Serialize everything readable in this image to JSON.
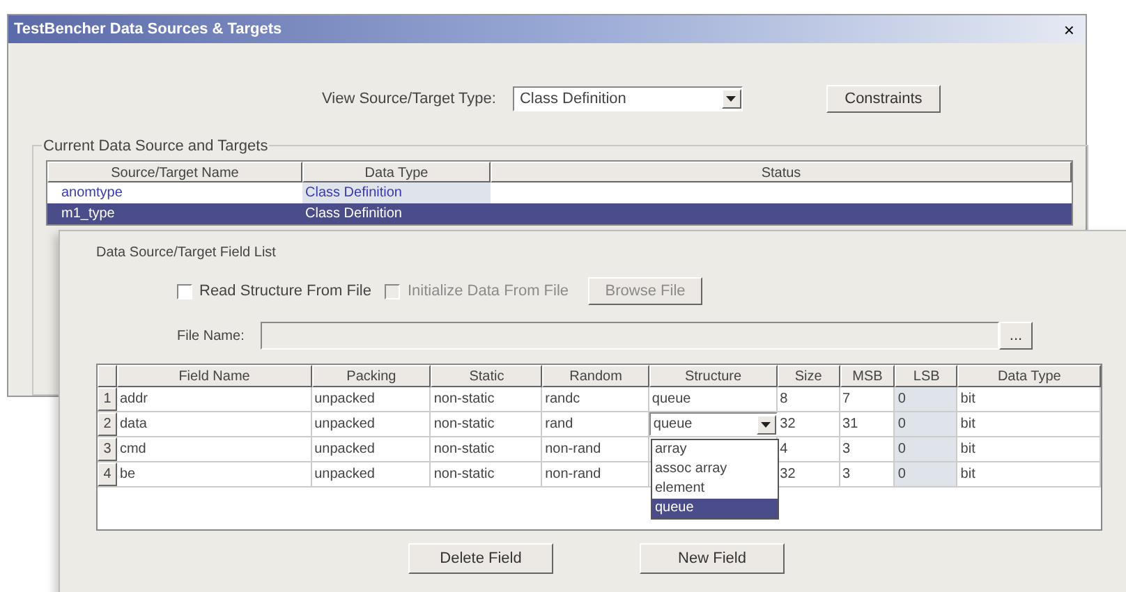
{
  "back_window": {
    "title": "TestBencher Data Sources & Targets",
    "close": "×",
    "type_label": "View Source/Target Type:",
    "type_value": "Class Definition",
    "constraints_button": "Constraints",
    "group_title": "Current Data Source and Targets",
    "columns": [
      "Source/Target Name",
      "Data Type",
      "Status"
    ],
    "rows": [
      {
        "name": "anomtype",
        "data_type": "Class Definition",
        "selected": false
      },
      {
        "name": "m1_type",
        "data_type": "Class Definition",
        "selected": true
      }
    ]
  },
  "field_panel": {
    "title": "Data Source/Target Field List",
    "checkboxes": [
      {
        "label": "Read Structure From File",
        "checked": false,
        "disabled": false
      },
      {
        "label": "Initialize Data From File",
        "checked": false,
        "disabled": true
      }
    ],
    "browse_button": {
      "label": "Browse File",
      "disabled": true
    },
    "file_name_label": "File Name:",
    "ellipsis_button": "...",
    "columns": [
      "Field Name",
      "Packing",
      "Static",
      "Random",
      "Structure",
      "Size",
      "MSB",
      "LSB",
      "Data Type"
    ],
    "rows": [
      {
        "index": "1",
        "cells": [
          "addr",
          "unpacked",
          "non-static",
          "randc",
          "queue",
          "8",
          "7",
          "0",
          "bit"
        ]
      },
      {
        "index": "2",
        "cells": [
          "data",
          "unpacked",
          "non-static",
          "rand",
          "queue",
          "32",
          "31",
          "0",
          "bit"
        ],
        "editing": true
      },
      {
        "index": "3",
        "cells": [
          "cmd",
          "unpacked",
          "non-static",
          "non-rand",
          "",
          "4",
          "3",
          "0",
          "bit"
        ]
      },
      {
        "index": "4",
        "cells": [
          "be",
          "unpacked",
          "non-static",
          "non-rand",
          "",
          "32",
          "3",
          "0",
          "bit"
        ]
      }
    ],
    "dropdown_options": [
      {
        "label": "array",
        "selected": false
      },
      {
        "label": "assoc array",
        "selected": false
      },
      {
        "label": "element",
        "selected": false
      },
      {
        "label": "queue",
        "selected": true
      }
    ],
    "buttons": [
      "Delete Field",
      "New Field"
    ]
  }
}
